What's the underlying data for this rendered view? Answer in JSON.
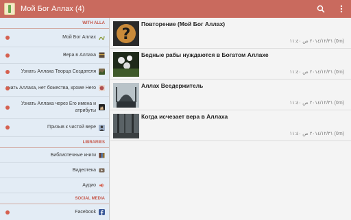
{
  "app": {
    "title": "Мой Бог Аллах (4)",
    "accent": "#c96a5e",
    "icons": {
      "app": "book-icon",
      "search": "search-icon",
      "overflow": "overflow-menu-icon"
    }
  },
  "sidebar": {
    "sections": [
      {
        "header": "WITH ALLA",
        "items": [
          {
            "label": "Мой Бог Аллах",
            "icon": "allah-calligraphy-icon",
            "badge": true
          },
          {
            "label": "Вера в Аллаха",
            "icon": "kaaba-icon",
            "badge": true
          },
          {
            "label": "Узнать Аллаха Творца Создателя",
            "icon": "creation-icon",
            "badge": true
          },
          {
            "label": "знать Аллаха, нет божества, кроме Него",
            "icon": "tawhid-icon",
            "badge": true
          },
          {
            "label": "Узнать Аллаха через Его имена и атрибуты",
            "icon": "hands-icon",
            "badge": true
          },
          {
            "label": "Призыв к чистой вере",
            "icon": "person-icon",
            "badge": true
          }
        ]
      },
      {
        "header": "LIBRARIES",
        "items": [
          {
            "label": "Библиотечные книги",
            "icon": "books-icon",
            "badge": false
          },
          {
            "label": "Видеотека",
            "icon": "video-icon",
            "badge": false
          },
          {
            "label": "Аудио",
            "icon": "speaker-icon",
            "badge": false
          }
        ]
      },
      {
        "header": "SOCIAL MEDIA",
        "items": [
          {
            "label": "Facebook",
            "icon": "facebook-icon",
            "badge": true
          }
        ]
      }
    ]
  },
  "posts": [
    {
      "title": "Повторение (Мой Бог Аллах)",
      "meta": "٢٠١٤/١٢/٣١ ص ١١:٤٠ (0m)",
      "thumb": "question-thumb"
    },
    {
      "title": "Бедные рабы нуждаются в Богатом Аллахе",
      "meta": "٢٠١٤/١٢/٣١ ص ١١:٤٠ (0m)",
      "thumb": "flowers-thumb"
    },
    {
      "title": "Аллах Вседержитель",
      "meta": "٢٠١٤/١٢/٣١ ص ١١:٤٠ (0m)",
      "thumb": "mosque-thumb"
    },
    {
      "title": "Когда исчезает вера в Аллаха",
      "meta": "٢٠١٤/١٢/٣١ ص ١١:٤٠ (0m)",
      "thumb": "forest-thumb"
    }
  ]
}
